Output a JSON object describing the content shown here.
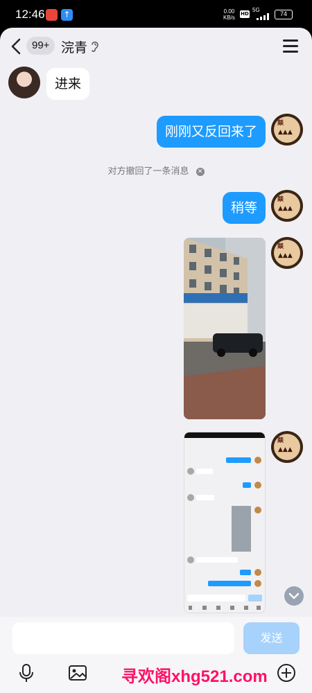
{
  "status_bar": {
    "time": "12:46",
    "net_speed": "0.00",
    "net_unit": "KB/s",
    "hd": "HD",
    "network": "5G",
    "battery": "74"
  },
  "header": {
    "unread_badge": "99+",
    "title": "浣青"
  },
  "messages": [
    {
      "side": "in",
      "type": "text",
      "text": "进来"
    },
    {
      "side": "out",
      "type": "text",
      "text": "刚刚又反回来了"
    },
    {
      "side": "system",
      "type": "recall",
      "text": "对方撤回了一条消息"
    },
    {
      "side": "out",
      "type": "text",
      "text": "稍等"
    },
    {
      "side": "out",
      "type": "image",
      "image": "street-photo"
    },
    {
      "side": "out",
      "type": "image",
      "image": "chat-screenshot"
    }
  ],
  "composer": {
    "placeholder": "",
    "send_label": "发送"
  },
  "toolbar": {
    "icons": [
      "microphone-icon",
      "image-icon",
      "add-icon"
    ]
  },
  "watermark": "寻欢阁xhg521.com",
  "colors": {
    "accent": "#1e9bff",
    "send_disabled": "#a6d2fb",
    "background": "#f0f0f4"
  }
}
